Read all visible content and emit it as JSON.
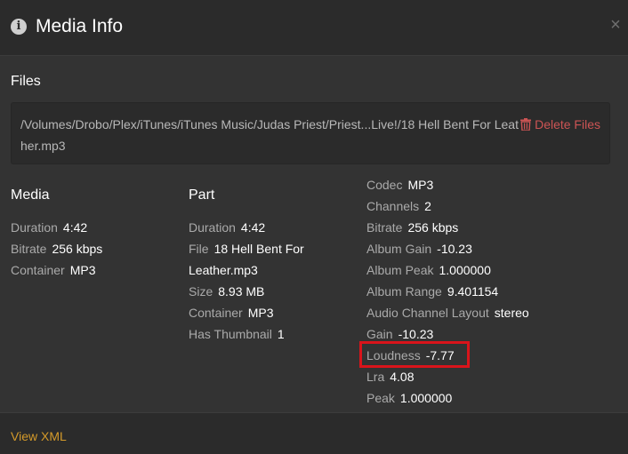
{
  "dialog": {
    "title": "Media Info",
    "close_label": "×",
    "info_icon": "i"
  },
  "files": {
    "heading": "Files",
    "path": "/Volumes/Drobo/Plex/iTunes/iTunes Music/Judas Priest/Priest...Live!/18 Hell Bent For Leather.mp3",
    "delete_label": "Delete Files"
  },
  "media": {
    "heading": "Media",
    "duration_label": "Duration",
    "duration_value": "4:42",
    "bitrate_label": "Bitrate",
    "bitrate_value": "256 kbps",
    "container_label": "Container",
    "container_value": "MP3"
  },
  "part": {
    "heading": "Part",
    "duration_label": "Duration",
    "duration_value": "4:42",
    "file_label": "File",
    "file_value_line1": "18 Hell Bent For",
    "file_value_line2": "Leather.mp3",
    "size_label": "Size",
    "size_value": "8.93 MB",
    "container_label": "Container",
    "container_value": "MP3",
    "thumbnail_label": "Has Thumbnail",
    "thumbnail_value": "1"
  },
  "stream": {
    "codec_label": "Codec",
    "codec_value": "MP3",
    "channels_label": "Channels",
    "channels_value": "2",
    "bitrate_label": "Bitrate",
    "bitrate_value": "256 kbps",
    "album_gain_label": "Album Gain",
    "album_gain_value": "-10.23",
    "album_peak_label": "Album Peak",
    "album_peak_value": "1.000000",
    "album_range_label": "Album Range",
    "album_range_value": "9.401154",
    "layout_label": "Audio Channel Layout",
    "layout_value": "stereo",
    "gain_label": "Gain",
    "gain_value": "-10.23",
    "loudness_label": "Loudness",
    "loudness_value": "-7.77",
    "lra_label": "Lra",
    "lra_value": "4.08",
    "peak_label": "Peak",
    "peak_value": "1.000000"
  },
  "footer": {
    "view_xml_label": "View XML"
  },
  "colors": {
    "background": "#333333",
    "header": "#2b2b2b",
    "accent_link": "#d49a2a",
    "danger": "#cc5454",
    "highlight_box": "#d9141b"
  },
  "icons": [
    "info-icon",
    "close-icon",
    "trash-icon"
  ]
}
